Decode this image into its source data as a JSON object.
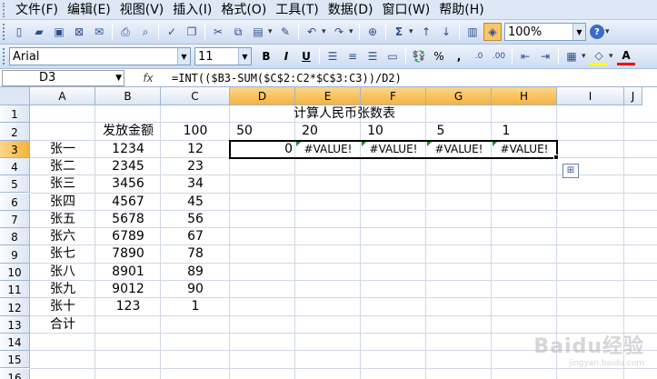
{
  "menu": [
    "文件(F)",
    "编辑(E)",
    "视图(V)",
    "插入(I)",
    "格式(O)",
    "工具(T)",
    "数据(D)",
    "窗口(W)",
    "帮助(H)"
  ],
  "toolbar": {
    "zoom": "100%",
    "font_name": "Arial",
    "font_size": "11",
    "bold": "B",
    "italic": "I",
    "underline": "U",
    "sum": "Σ",
    "percent": "%",
    "comma": ",",
    "align_left_icon": "align-left-icon",
    "align_center_icon": "align-center-icon",
    "align_right_icon": "align-right-icon",
    "merge_icon": "merge-center-icon",
    "font_color": "A",
    "help": "?"
  },
  "formula_bar": {
    "name_box": "D3",
    "fx": "fx",
    "formula": "=INT(($B3-SUM($C$2:C2*$C$3:C3))/D2)"
  },
  "columns": [
    "A",
    "B",
    "C",
    "D",
    "E",
    "F",
    "G",
    "H",
    "I",
    "J"
  ],
  "rows": [
    "1",
    "2",
    "3",
    "4",
    "5",
    "6",
    "7",
    "8",
    "9",
    "10",
    "11",
    "12",
    "13",
    "14",
    "15",
    "16"
  ],
  "sheet": {
    "title": "计算人民币张数表",
    "header_b2": "发放金额",
    "c2": "100",
    "denominations": [
      "50",
      "20",
      "10",
      "5",
      "1"
    ],
    "row3_results": [
      "0",
      "#VALUE!",
      "#VALUE!",
      "#VALUE!",
      "#VALUE!"
    ],
    "names": [
      "张一",
      "张二",
      "张三",
      "张四",
      "张五",
      "张六",
      "张七",
      "张八",
      "张九",
      "张十"
    ],
    "amounts": [
      "1234",
      "2345",
      "3456",
      "4567",
      "5678",
      "6789",
      "7890",
      "8901",
      "9012",
      "123"
    ],
    "c_values": [
      "12",
      "23",
      "34",
      "45",
      "56",
      "67",
      "78",
      "89",
      "90",
      "1"
    ],
    "total_label": "合计"
  },
  "watermark": {
    "brand": "Baidu经验",
    "sub": "jingyan.baidu.com"
  }
}
